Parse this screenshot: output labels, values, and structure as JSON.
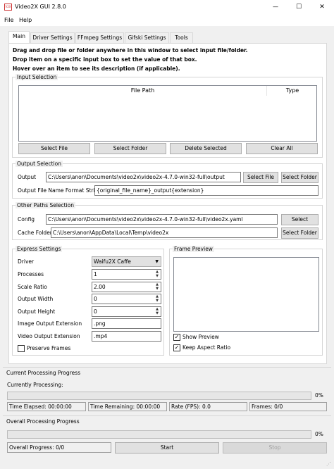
{
  "window": {
    "title": "Video2X GUI 2.8.0",
    "controls": {
      "minimize": "—",
      "maximize": "☐",
      "close": "✕"
    }
  },
  "menu": {
    "file": "File",
    "help": "Help"
  },
  "tabs": [
    {
      "label": "Main"
    },
    {
      "label": "Driver Settings"
    },
    {
      "label": "FFmpeg Settings"
    },
    {
      "label": "Gifski Settings"
    },
    {
      "label": "Tools"
    }
  ],
  "instructions": [
    "Drag and drop file or folder anywhere in this window to select input file/folder.",
    "Drop item on a specific input box to set the value of that box.",
    "Hover over an item to see its description (if applicable)."
  ],
  "input_selection": {
    "title": "Input Selection",
    "columns": {
      "path": "File Path",
      "type": "Type"
    },
    "buttons": {
      "select_file": "Select File",
      "select_folder": "Select Folder",
      "delete_selected": "Delete Selected",
      "clear_all": "Clear All"
    }
  },
  "output_selection": {
    "title": "Output Selection",
    "output_label": "Output",
    "output_value": "C:\\Users\\anon\\Documents\\video2x\\video2x-4.7.0-win32-full\\output",
    "select_file": "Select File",
    "select_folder": "Select Folder",
    "format_label": "Output File Name Format String",
    "format_value": "{original_file_name}_output{extension}"
  },
  "other_paths": {
    "title": "Other Paths Selection",
    "config_label": "Config",
    "config_value": "C:\\Users\\anon\\Documents\\video2x\\video2x-4.7.0-win32-full\\video2x.yaml",
    "config_select": "Select",
    "cache_label": "Cache Folder",
    "cache_value": "C:\\Users\\anon\\AppData\\Local\\Temp\\video2x",
    "cache_select": "Select Folder"
  },
  "express": {
    "title": "Express Settings",
    "driver_label": "Driver",
    "driver_value": "Waifu2X Caffe",
    "processes_label": "Processes",
    "processes_value": "1",
    "scale_label": "Scale Ratio",
    "scale_value": "2.00",
    "width_label": "Output Width",
    "width_value": "0",
    "height_label": "Output Height",
    "height_value": "0",
    "img_ext_label": "Image Output Extension",
    "img_ext_value": ".png",
    "vid_ext_label": "Video Output Extension",
    "vid_ext_value": ".mp4",
    "preserve_label": "Preserve Frames",
    "preserve_checked": false
  },
  "preview": {
    "title": "Frame Preview",
    "show_label": "Show Preview",
    "show_checked": true,
    "aspect_label": "Keep Aspect Ratio",
    "aspect_checked": true
  },
  "current_progress": {
    "title": "Current Processing Progress",
    "processing_label": "Currently Processing:",
    "percent": "0%",
    "progress_fraction": 0,
    "elapsed": "Time Elapsed: 00:00:00",
    "remaining": "Time Remaining: 00:00:00",
    "rate": "Rate (FPS): 0.0",
    "frames": "Frames: 0/0"
  },
  "overall_progress": {
    "title": "Overall Processing Progress",
    "percent": "0%",
    "progress_fraction": 0,
    "overall_label": "Overall Progress: 0/0",
    "start": "Start",
    "stop": "Stop"
  },
  "colors": {
    "window_bg": "#f0f0f0",
    "button": "#e1e1e1",
    "disabled_text": "#a0a0a0"
  }
}
